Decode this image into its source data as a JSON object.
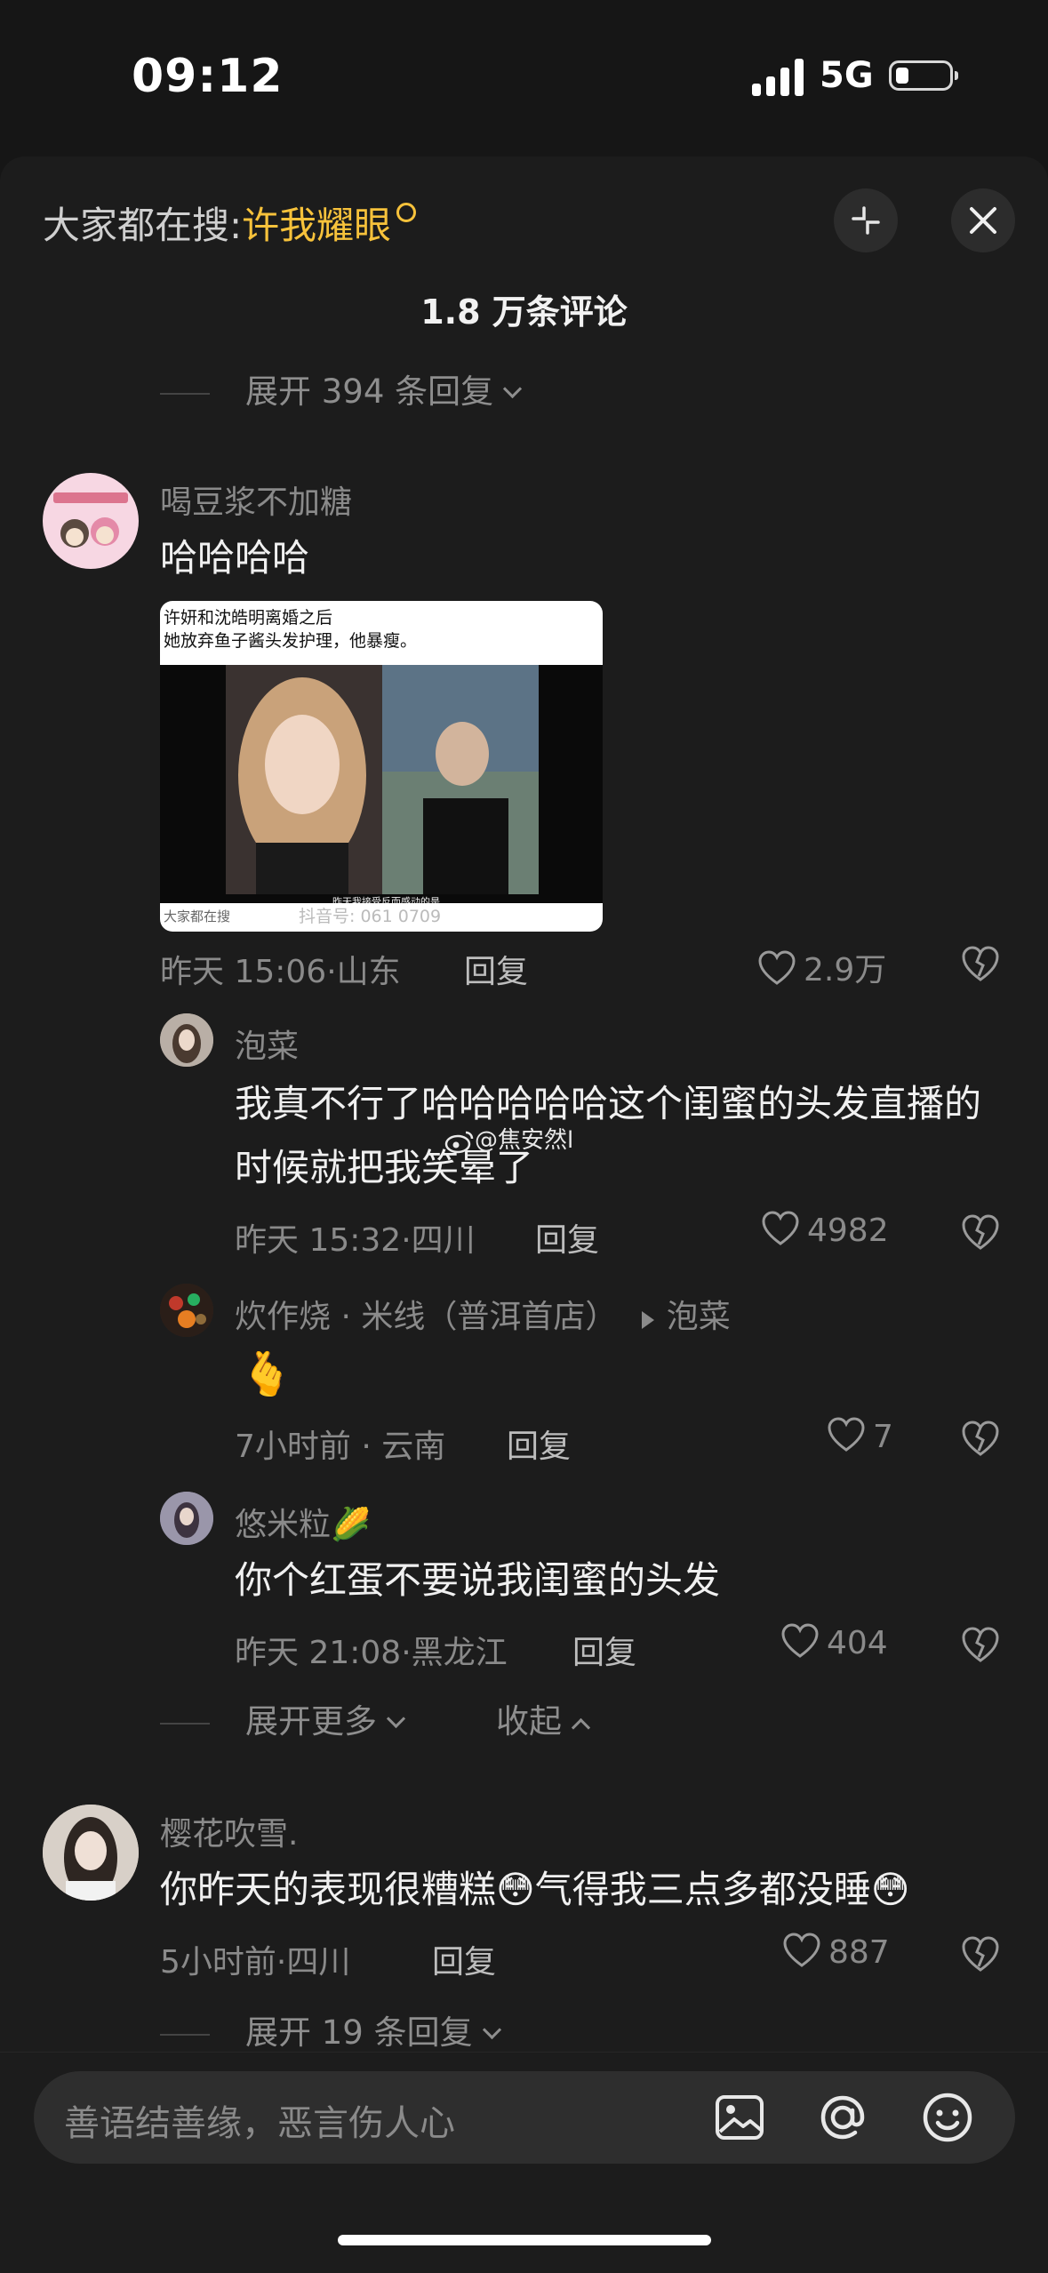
{
  "status": {
    "time": "09:12",
    "network": "5G"
  },
  "header": {
    "search_prefix": "大家都在搜:",
    "search_keyword": "许我耀眼",
    "count": "1.8 万条评论"
  },
  "top_expand": "展开 394 条回复",
  "comments": [
    {
      "user": "喝豆浆不加糖",
      "text": "哈哈哈哈",
      "image": {
        "caption_line1": "许妍和沈皓明离婚之后",
        "caption_line2": "她放弃鱼子酱头发护理，他暴瘦。",
        "bottom_caption": "大家都在搜",
        "subtitle": "昨天我接受反而感动的是",
        "watermark": "抖音号: 061 0709"
      },
      "time": "昨天 15:06",
      "location": "山东",
      "reply": "回复",
      "likes": "2.9万",
      "replies": [
        {
          "user": "泡菜",
          "text": "我真不行了哈哈哈哈哈这个闺蜜的头发直播的时候就把我笑晕了",
          "time": "昨天 15:32",
          "location": "四川",
          "reply": "回复",
          "likes": "4982"
        },
        {
          "user": "炊作烧 · 米线（普洱首店）",
          "reply_to": "泡菜",
          "text": "🫰",
          "time": "7小时前",
          "location": "云南",
          "reply": "回复",
          "likes": "7"
        },
        {
          "user": "悠米粒🌽",
          "text": "你个红蛋不要说我闺蜜的头发",
          "time": "昨天 21:08",
          "location": "黑龙江",
          "reply": "回复",
          "likes": "404"
        }
      ],
      "expand_more": "展开更多",
      "collapse": "收起"
    },
    {
      "user": "樱花吹雪.",
      "text": "你昨天的表现很糟糕😳气得我三点多都没睡😳",
      "time": "5小时前",
      "location": "四川",
      "reply": "回复",
      "likes": "887",
      "expand": "展开 19 条回复"
    }
  ],
  "watermark": "@焦安然l",
  "input": {
    "placeholder": "善语结善缘，恶言伤人心"
  },
  "icons": [
    "signal-icon",
    "battery-icon",
    "search-icon",
    "minimize-icon",
    "close-icon",
    "heart-icon",
    "dislike-icon",
    "chevron-down-icon",
    "chevron-up-icon",
    "image-icon",
    "at-icon",
    "emoji-icon"
  ]
}
